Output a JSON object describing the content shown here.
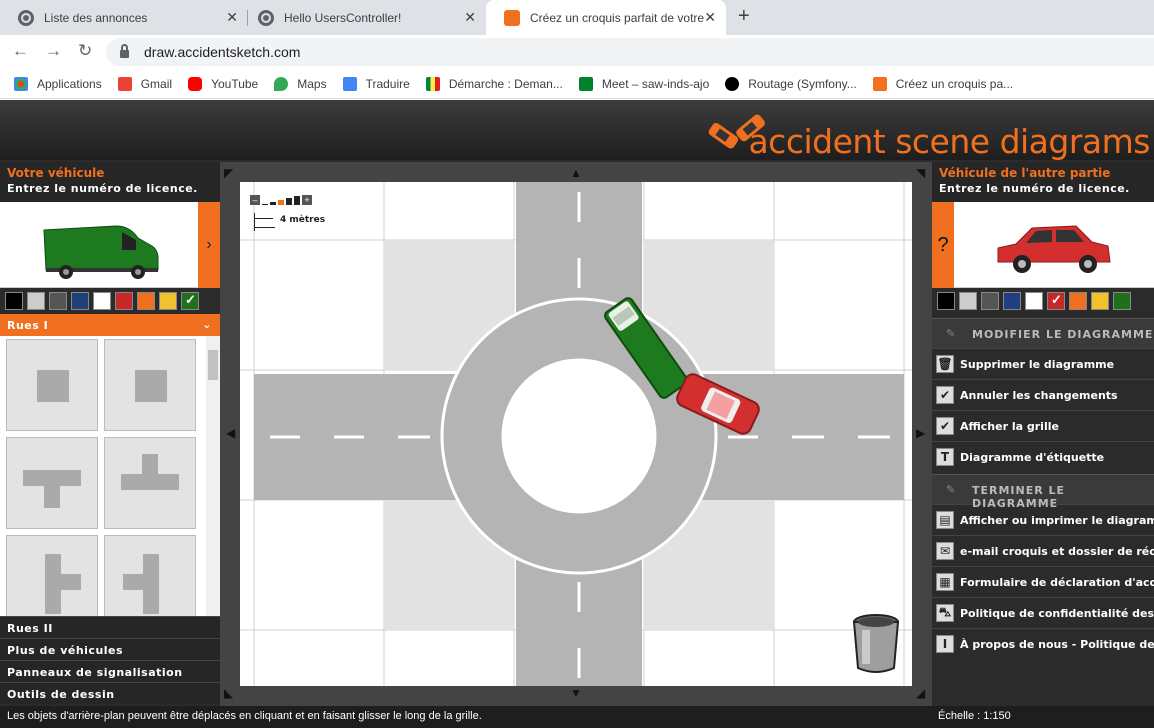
{
  "browser": {
    "tabs": [
      {
        "title": "Liste des annonces"
      },
      {
        "title": "Hello UsersController!"
      },
      {
        "title": "Créez un croquis parfait de votre"
      }
    ],
    "url": "draw.accidentsketch.com",
    "bookmarks": [
      "Applications",
      "Gmail",
      "YouTube",
      "Maps",
      "Traduire",
      "Démarche : Deman...",
      "Meet – saw-inds-ajo",
      "Routage (Symfony...",
      "Créez un croquis pa..."
    ]
  },
  "app": {
    "logo": "accident scene diagrams",
    "left": {
      "title": "Votre véhicule",
      "subtitle": "Entrez le numéro de licence.",
      "side_arrow": "›",
      "swatch_colors": [
        "#000000",
        "#cccccc",
        "#555555",
        "#1f3f7f",
        "#ffffff",
        "#c62828",
        "#f07020",
        "#f2c12e",
        "#1f6f1f"
      ],
      "selected_swatch": 8,
      "active_section": "Rues I",
      "sections": [
        "Rues II",
        "Plus de véhicules",
        "Panneaux de signalisation",
        "Outils de dessin"
      ]
    },
    "canvas": {
      "zoom_controls": "–",
      "zoom_plus": "+",
      "scale_label": "4 mètres"
    },
    "status": "Les objets d'arrière-plan peuvent être déplacés en cliquant et en faisant glisser le long de la grille.",
    "right": {
      "title": "Véhicule de l'autre partie",
      "subtitle": "Entrez le numéro de licence.",
      "side_mark": "?",
      "swatch_colors": [
        "#000000",
        "#cccccc",
        "#555555",
        "#1f3f7f",
        "#ffffff",
        "#c62828",
        "#f07020",
        "#f2c12e",
        "#1f6f1f"
      ],
      "selected_swatch": 5,
      "modify_header": "MODIFIER LE DIAGRAMME",
      "modify_items": [
        "Supprimer le diagramme",
        "Annuler les changements",
        "Afficher la grille",
        "Diagramme d'étiquette"
      ],
      "finish_header": "TERMINER LE DIAGRAMME",
      "finish_items": [
        "Afficher ou imprimer le diagramme",
        "e-mail croquis et dossier de réclamation",
        "Formulaire de déclaration d'accident",
        "Politique de confidentialité des données",
        "À propos de nous - Politique de confidentialité"
      ],
      "scale": "Échelle : 1:150"
    }
  }
}
